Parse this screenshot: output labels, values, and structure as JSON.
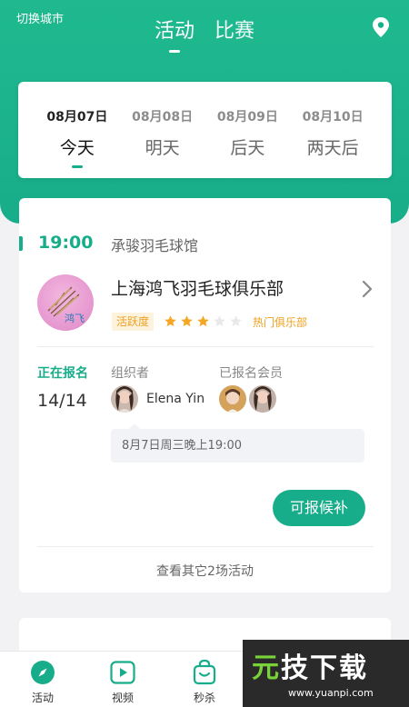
{
  "header": {
    "switch_city": "切换城市",
    "tabs": [
      {
        "label": "活动",
        "active": true
      },
      {
        "label": "比赛",
        "active": false
      }
    ],
    "location_icon": "location-pin-icon",
    "color": "#18ad8a"
  },
  "dates": [
    {
      "date": "08月07日",
      "label": "今天",
      "active": true
    },
    {
      "date": "08月08日",
      "label": "明天",
      "active": false
    },
    {
      "date": "08月09日",
      "label": "后天",
      "active": false
    },
    {
      "date": "08月10日",
      "label": "两天后",
      "active": false
    }
  ],
  "event": {
    "time": "19:00",
    "venue": "承骏羽毛球馆",
    "club_name": "上海鸿飞羽毛球俱乐部",
    "activity_label": "活跃度",
    "activity_rating": 3,
    "activity_max": 5,
    "hot_tag": "热门俱乐部",
    "status": "正在报名",
    "count": "14/14",
    "organizer_label": "组织者",
    "organizer_name": "Elena Yin",
    "members_label": "已报名会员",
    "note": "8月7日周三晚上19:00",
    "waitlist_button": "可报候补",
    "more_link": "查看其它2场活动"
  },
  "bottom_nav": [
    {
      "label": "活动",
      "icon": "compass-icon"
    },
    {
      "label": "视频",
      "icon": "play-icon"
    },
    {
      "label": "秒杀",
      "icon": "bag-icon"
    }
  ],
  "watermark": {
    "title_part1": "元",
    "title_part2": "技下载",
    "url": "www.yuanpi.com"
  }
}
